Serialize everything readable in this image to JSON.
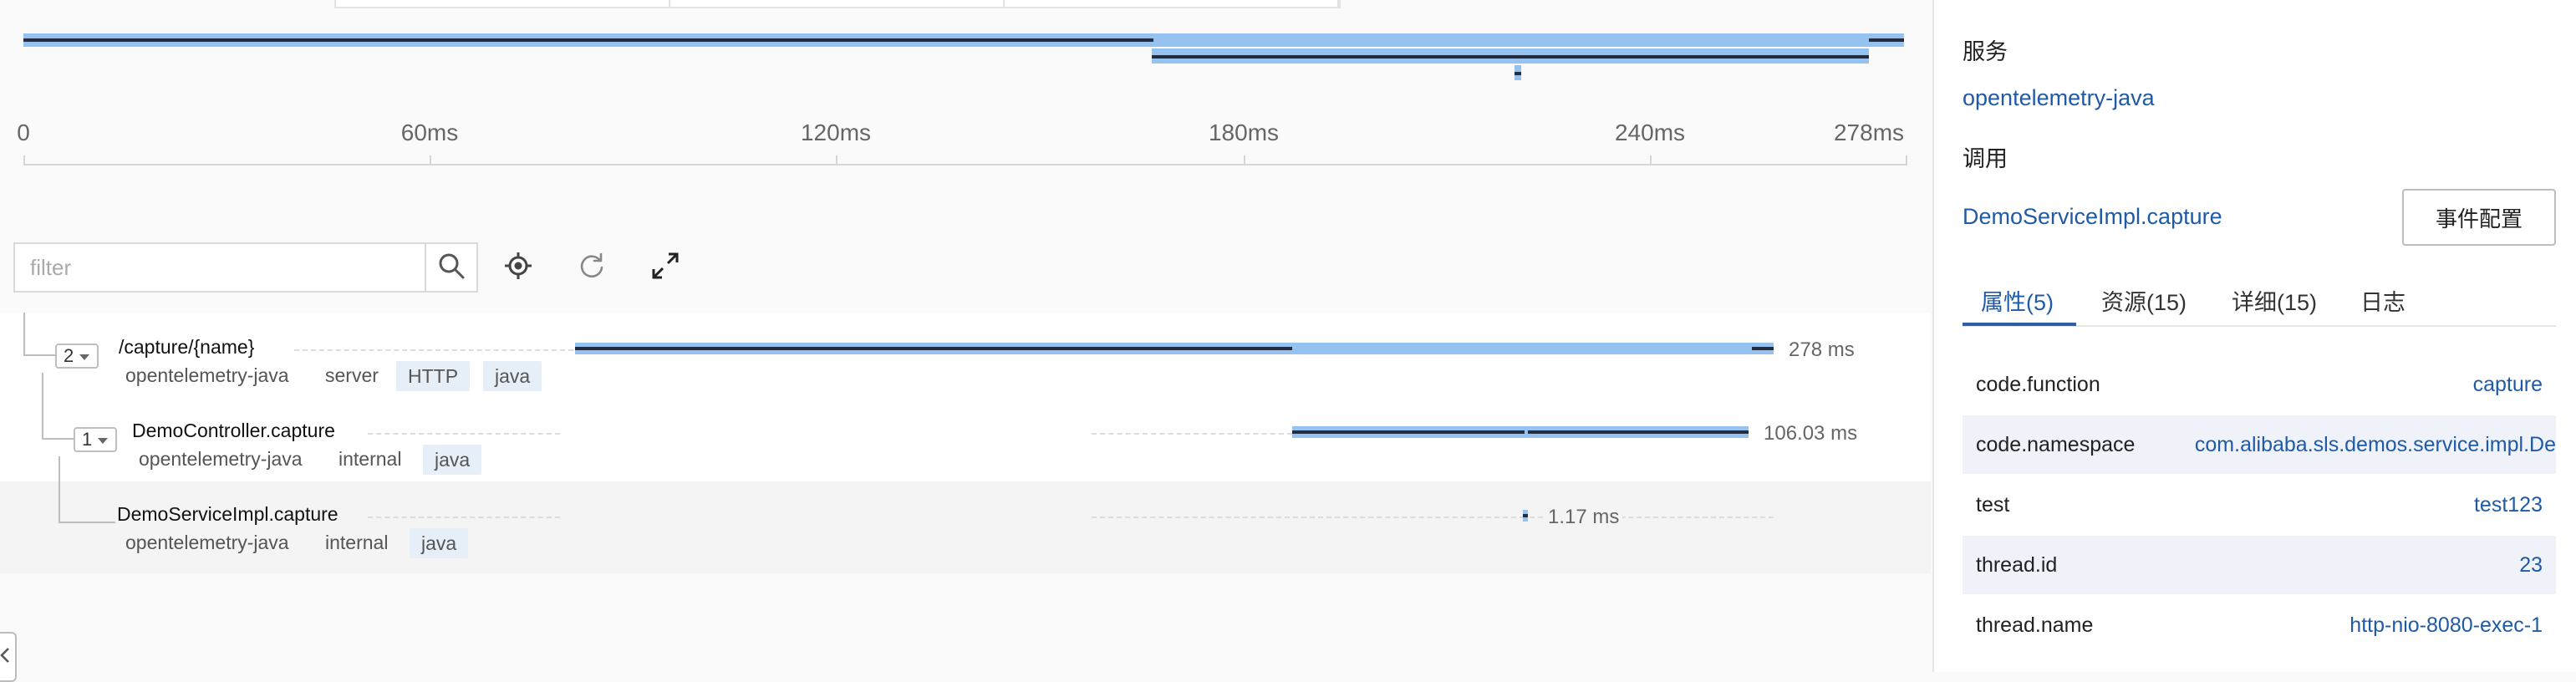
{
  "axis": {
    "ticks": [
      "0",
      "60ms",
      "120ms",
      "180ms",
      "240ms",
      "278ms"
    ]
  },
  "toolbar": {
    "filter_placeholder": "filter",
    "icons": [
      "search-icon",
      "locate-icon",
      "refresh-icon",
      "expand-icon"
    ]
  },
  "spans": [
    {
      "toggle": "2",
      "name": "/capture/{name}",
      "service": "opentelemetry-java",
      "kind": "server",
      "tags": [
        "HTTP",
        "java"
      ],
      "duration": "278 ms"
    },
    {
      "toggle": "1",
      "name": "DemoController.capture",
      "service": "opentelemetry-java",
      "kind": "internal",
      "tags": [
        "java"
      ],
      "duration": "106.03 ms"
    },
    {
      "name": "DemoServiceImpl.capture",
      "service": "opentelemetry-java",
      "kind": "internal",
      "tags": [
        "java"
      ],
      "duration": "1.17 ms"
    }
  ],
  "panel": {
    "service_label": "服务",
    "service_value": "opentelemetry-java",
    "call_label": "调用",
    "call_value": "DemoServiceImpl.capture",
    "event_button": "事件配置",
    "tabs": [
      "属性(5)",
      "资源(15)",
      "详细(15)",
      "日志"
    ],
    "active_tab": "属性(5)",
    "attributes": [
      {
        "key": "code.function",
        "value": "capture"
      },
      {
        "key": "code.namespace",
        "value": "com.alibaba.sls.demos.service.impl.De"
      },
      {
        "key": "test",
        "value": "test123"
      },
      {
        "key": "thread.id",
        "value": "23"
      },
      {
        "key": "thread.name",
        "value": "http-nio-8080-exec-1"
      }
    ]
  },
  "colors": {
    "bar": "#95c2ee",
    "bar_line": "#222e40",
    "link": "#1f5aa6",
    "row_alt": "#eff3f9"
  }
}
